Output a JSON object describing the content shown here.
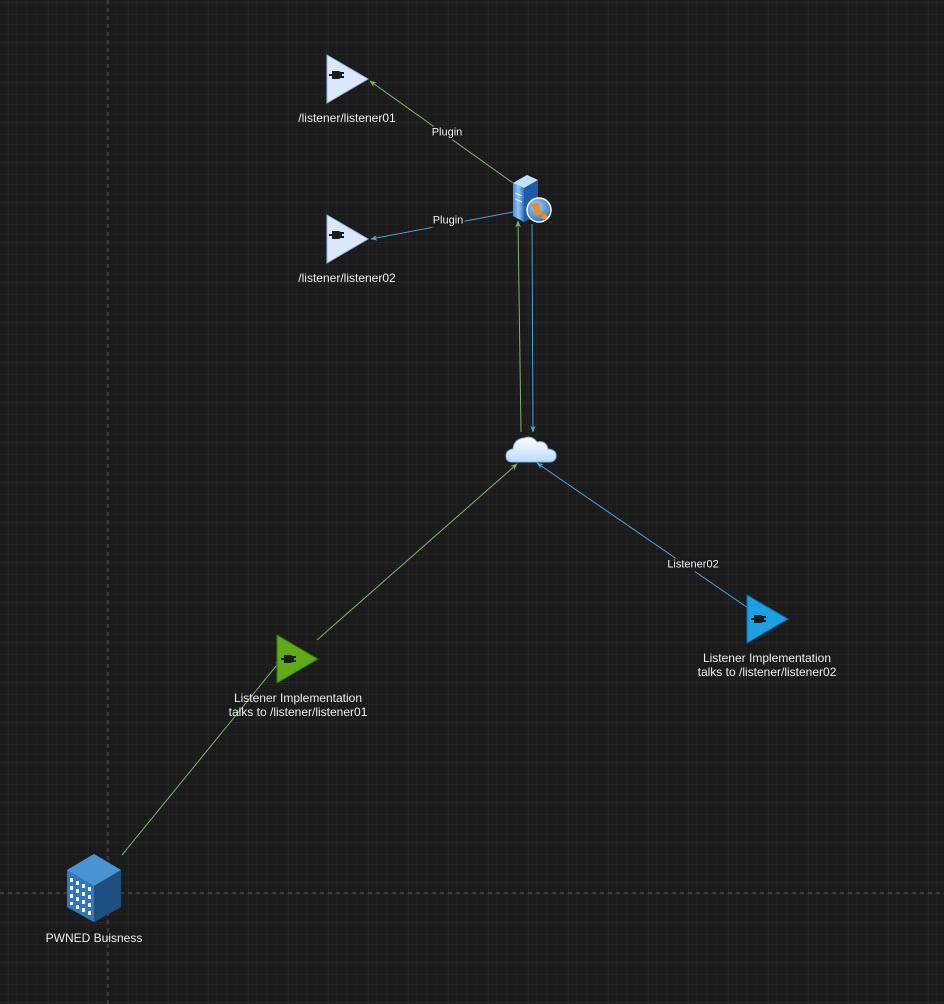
{
  "diagram": {
    "nodes": {
      "listener01": {
        "label": "/listener/listener01",
        "icon": "plugin-triangle-icon",
        "color": "#dae8fc"
      },
      "listener02": {
        "label": "/listener/listener02",
        "icon": "plugin-triangle-icon",
        "color": "#dae8fc"
      },
      "web_server": {
        "icon": "web-server-icon"
      },
      "cloud": {
        "icon": "cloud-icon"
      },
      "impl01": {
        "label_line1": "Listener Implementation",
        "label_line2": "talks to /listener/listener01",
        "icon": "plugin-triangle-icon",
        "color": "#60a917"
      },
      "impl02": {
        "label_line1": "Listener Implementation",
        "label_line2": "talks to /listener/listener02",
        "icon": "plugin-triangle-icon",
        "color": "#1ba1e2"
      },
      "business": {
        "label": "PWNED Buisness",
        "icon": "office-building-icon",
        "color": "#2d6ea4"
      }
    },
    "edges": {
      "server_to_listener01": {
        "label": "Plugin",
        "color": "#82b366"
      },
      "server_to_listener02": {
        "label": "Plugin",
        "color": "#4ba3db"
      },
      "cloud_to_impl02": {
        "label": "Listener02",
        "color": "#4ba3db"
      },
      "green_color": "#82b366",
      "blue_color": "#4ba3db"
    }
  },
  "theme": {
    "background": "#1b1b1b",
    "grid_minor": "#262626",
    "grid_major": "#303030",
    "page_break": "#5a5a5a"
  }
}
